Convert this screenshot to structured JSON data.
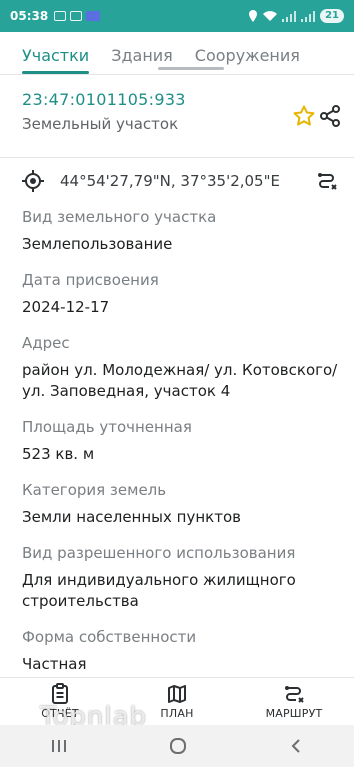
{
  "status_bar": {
    "time": "05:38",
    "battery": "21"
  },
  "tabs": [
    {
      "label": "Участки"
    },
    {
      "label": "Здания"
    },
    {
      "label": "Сооружения"
    }
  ],
  "header": {
    "cadastral_number": "23:47:0101105:933",
    "object_type": "Земельный участок"
  },
  "coordinates": "44°54'27,79\"N, 37°35'2,05\"E",
  "fields": [
    {
      "label": "Вид земельного участка",
      "value": "Землепользование"
    },
    {
      "label": "Дата присвоения",
      "value": "2024-12-17"
    },
    {
      "label": "Адрес",
      "value": "район ул. Молодежная/ ул. Котовского/ ул. Заповедная, участок 4"
    },
    {
      "label": "Площадь уточненная",
      "value": "523 кв. м"
    },
    {
      "label": "Категория земель",
      "value": "Земли населенных пунктов"
    },
    {
      "label": "Вид разрешенного использования",
      "value": "Для индивидуального жилищного строительства"
    },
    {
      "label": "Форма собственности",
      "value": "Частная"
    }
  ],
  "bottom_nav": [
    {
      "label": "ОТЧЁТ",
      "icon": "report-icon"
    },
    {
      "label": "ПЛАН",
      "icon": "map-icon"
    },
    {
      "label": "МАРШРУТ",
      "icon": "route-icon"
    }
  ],
  "watermark": "Topnlab",
  "colors": {
    "accent": "#1e8f87",
    "status_bar": "#28a39a",
    "star": "#e7b400"
  }
}
